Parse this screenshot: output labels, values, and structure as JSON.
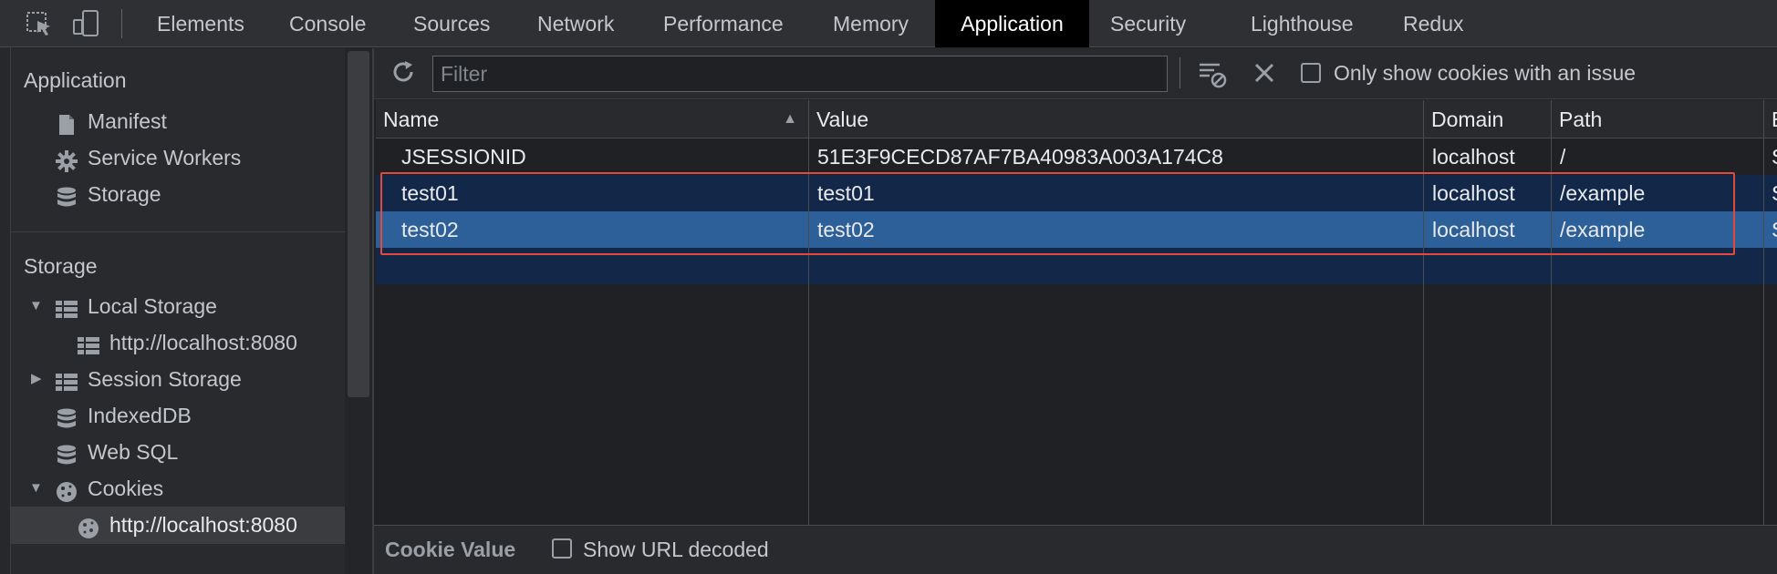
{
  "tabs": [
    {
      "label": "Elements",
      "active": false
    },
    {
      "label": "Console",
      "active": false
    },
    {
      "label": "Sources",
      "active": false
    },
    {
      "label": "Network",
      "active": false
    },
    {
      "label": "Performance",
      "active": false
    },
    {
      "label": "Memory",
      "active": false
    },
    {
      "label": "Application",
      "active": true
    },
    {
      "label": "Security",
      "active": false
    },
    {
      "label": "Lighthouse",
      "active": false
    },
    {
      "label": "Redux",
      "active": false
    }
  ],
  "toolbar_icons": {
    "inspect": "inspect-element-icon",
    "device": "device-toggle-icon"
  },
  "sidebar": {
    "application_heading": "Application",
    "application_items": [
      {
        "label": "Manifest",
        "icon": "document-icon"
      },
      {
        "label": "Service Workers",
        "icon": "gear-icon"
      },
      {
        "label": "Storage",
        "icon": "database-icon"
      }
    ],
    "storage_heading": "Storage",
    "storage_items": [
      {
        "label": "Local Storage",
        "icon": "grid-icon",
        "expander": "▼"
      },
      {
        "label": "http://localhost:8080",
        "icon": "grid-icon",
        "expander": ""
      },
      {
        "label": "Session Storage",
        "icon": "grid-icon",
        "expander": "▶"
      },
      {
        "label": "IndexedDB",
        "icon": "database-icon",
        "expander": ""
      },
      {
        "label": "Web SQL",
        "icon": "database-icon",
        "expander": ""
      },
      {
        "label": "Cookies",
        "icon": "cookie-icon",
        "expander": "▼"
      },
      {
        "label": "http://localhost:8080",
        "icon": "cookie-icon",
        "expander": "",
        "selected": true
      }
    ]
  },
  "filter": {
    "placeholder": "Filter",
    "value": ""
  },
  "only_issue_label": "Only show cookies with an issue",
  "table": {
    "columns": [
      "Name",
      "Value",
      "Domain",
      "Path",
      "E"
    ],
    "sort_indicator": "▲",
    "rows": [
      {
        "name": "JSESSIONID",
        "value": "51E3F9CECD87AF7BA40983A003A174C8",
        "domain": "localhost",
        "path": "/",
        "extra": "S"
      },
      {
        "name": "test01",
        "value": "test01",
        "domain": "localhost",
        "path": "/example",
        "extra": "S"
      },
      {
        "name": "test02",
        "value": "test02",
        "domain": "localhost",
        "path": "/example",
        "extra": "S"
      }
    ]
  },
  "bottom": {
    "cookie_value_label": "Cookie Value",
    "show_decoded_label": "Show URL decoded"
  },
  "colors": {
    "selected_row": "#2d6099",
    "highlight_row": "#132849",
    "outline": "#e34a3b",
    "accent": "#000000"
  }
}
